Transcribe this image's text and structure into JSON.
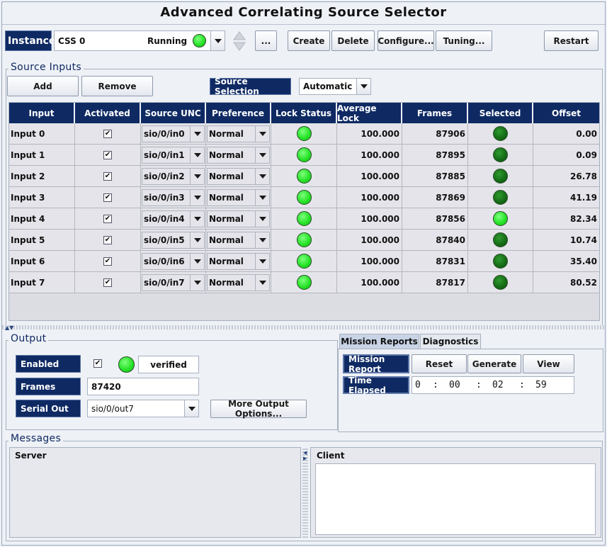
{
  "app": {
    "title": "Advanced Correlating Source Selector"
  },
  "toolbar": {
    "instance_label": "Instance",
    "instance_name": "CSS 0",
    "instance_status": "Running",
    "ellipsis_label": "...",
    "create_label": "Create",
    "delete_label": "Delete",
    "configure_label": "Configure...",
    "tuning_label": "Tuning...",
    "restart_label": "Restart",
    "status_color": "#22e022"
  },
  "source_inputs": {
    "group_title": "Source Inputs",
    "add_label": "Add",
    "remove_label": "Remove",
    "source_selection_label": "Source Selection",
    "source_selection_value": "Automatic",
    "columns": [
      "Input",
      "Activated",
      "Source UNC",
      "Preference",
      "Lock Status",
      "Average Lock",
      "Frames",
      "Selected",
      "Offset"
    ],
    "rows": [
      {
        "input": "Input 0",
        "activated": "✔",
        "source_unc": "sio/0/in0",
        "preference": "Normal",
        "lock": "on",
        "avg_lock": "100.000",
        "frames": "87906",
        "selected": "dim",
        "offset": "0.00"
      },
      {
        "input": "Input 1",
        "activated": "✔",
        "source_unc": "sio/0/in1",
        "preference": "Normal",
        "lock": "on",
        "avg_lock": "100.000",
        "frames": "87895",
        "selected": "dim",
        "offset": "0.09"
      },
      {
        "input": "Input 2",
        "activated": "✔",
        "source_unc": "sio/0/in2",
        "preference": "Normal",
        "lock": "on",
        "avg_lock": "100.000",
        "frames": "87885",
        "selected": "dim",
        "offset": "26.78"
      },
      {
        "input": "Input 3",
        "activated": "✔",
        "source_unc": "sio/0/in3",
        "preference": "Normal",
        "lock": "on",
        "avg_lock": "100.000",
        "frames": "87869",
        "selected": "dim",
        "offset": "41.19"
      },
      {
        "input": "Input 4",
        "activated": "✔",
        "source_unc": "sio/0/in4",
        "preference": "Normal",
        "lock": "on",
        "avg_lock": "100.000",
        "frames": "87856",
        "selected": "on",
        "offset": "82.34"
      },
      {
        "input": "Input 5",
        "activated": "✔",
        "source_unc": "sio/0/in5",
        "preference": "Normal",
        "lock": "on",
        "avg_lock": "100.000",
        "frames": "87840",
        "selected": "dim",
        "offset": "10.74"
      },
      {
        "input": "Input 6",
        "activated": "✔",
        "source_unc": "sio/0/in6",
        "preference": "Normal",
        "lock": "on",
        "avg_lock": "100.000",
        "frames": "87831",
        "selected": "dim",
        "offset": "35.40"
      },
      {
        "input": "Input 7",
        "activated": "✔",
        "source_unc": "sio/0/in7",
        "preference": "Normal",
        "lock": "on",
        "avg_lock": "100.000",
        "frames": "87817",
        "selected": "dim",
        "offset": "80.52"
      }
    ]
  },
  "output": {
    "group_title": "Output",
    "enabled_label": "Enabled",
    "enabled_check": "✔",
    "enabled_status": "verified",
    "frames_label": "Frames",
    "frames_value": "87420",
    "serial_out_label": "Serial Out",
    "serial_out_value": "sio/0/out7",
    "more_options_label": "More Output Options..."
  },
  "reports": {
    "tab_mission": "Mission Reports",
    "tab_diagnostics": "Diagnostics",
    "mission_report_label": "Mission Report",
    "reset_label": "Reset",
    "generate_label": "Generate",
    "view_label": "View",
    "time_elapsed_label": "Time Elapsed",
    "elapsed": [
      "0",
      ":",
      "00",
      ":",
      "02",
      ":",
      "59"
    ]
  },
  "messages": {
    "group_title": "Messages",
    "server_label": "Server",
    "client_label": "Client"
  }
}
